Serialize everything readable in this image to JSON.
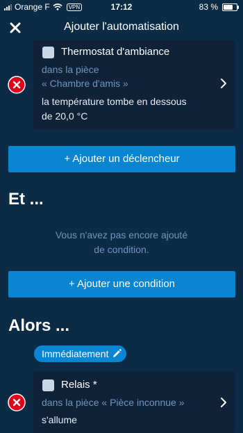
{
  "status_bar": {
    "carrier": "Orange F",
    "vpn": "VPN",
    "time": "17:12",
    "battery": "83 %",
    "battery_level": 0.83,
    "icons": [
      "signal-icon",
      "wifi-icon",
      "battery-icon"
    ]
  },
  "nav": {
    "title": "Ajouter l'automatisation",
    "close_icon": "close-icon"
  },
  "trigger_card": {
    "device_icon": "device-icon",
    "title": "Thermostat d'ambiance",
    "room_line1": "dans la pièce",
    "room_line2": "« Chambre d'amis »",
    "condition_line1": "la température tombe en dessous",
    "condition_line2": "de 20,0 °C"
  },
  "add_trigger_button": "+ Ajouter un déclencheur",
  "and_section": {
    "heading": "Et ...",
    "empty_line1": "Vous n'avez pas encore ajouté",
    "empty_line2": "de condition."
  },
  "add_condition_button": "+ Ajouter une condition",
  "then_section": {
    "heading": "Alors ...",
    "timing": "Immédiatement"
  },
  "action_card": {
    "device_icon": "device-icon",
    "title": "Relais *",
    "room": "dans la pièce « Pièce inconnue »",
    "action": "s'allume"
  },
  "colors": {
    "background": "#0c2c46",
    "card": "#0f2238",
    "accent": "#0a85d1",
    "secondary_text": "#6f96bd",
    "remove_red": "#e3001b"
  }
}
